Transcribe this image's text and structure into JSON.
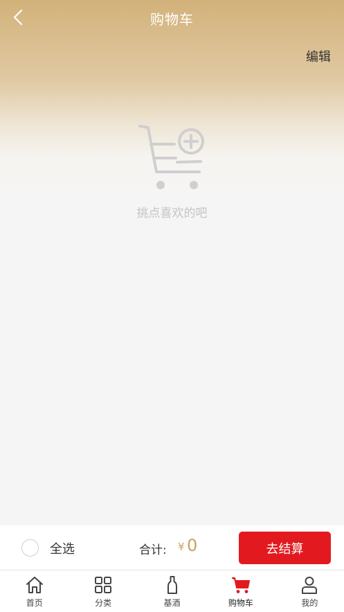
{
  "header": {
    "title": "购物车",
    "edit_label": "编辑"
  },
  "empty_state": {
    "message": "挑点喜欢的吧",
    "icon": "cart-add-icon"
  },
  "checkout": {
    "select_all_label": "全选",
    "total_label": "合计:",
    "currency_symbol": "¥",
    "total_amount": "0",
    "checkout_button": "去结算"
  },
  "tabbar": {
    "items": [
      {
        "label": "首页",
        "icon": "home-icon"
      },
      {
        "label": "分类",
        "icon": "grid-icon"
      },
      {
        "label": "基酒",
        "icon": "bottle-icon"
      },
      {
        "label": "购物车",
        "icon": "cart-icon",
        "active": true
      },
      {
        "label": "我的",
        "icon": "user-icon"
      }
    ]
  },
  "colors": {
    "accent_red": "#e21a1f",
    "gold": "#c9a066",
    "header_gradient_top": "#d2b27a"
  }
}
